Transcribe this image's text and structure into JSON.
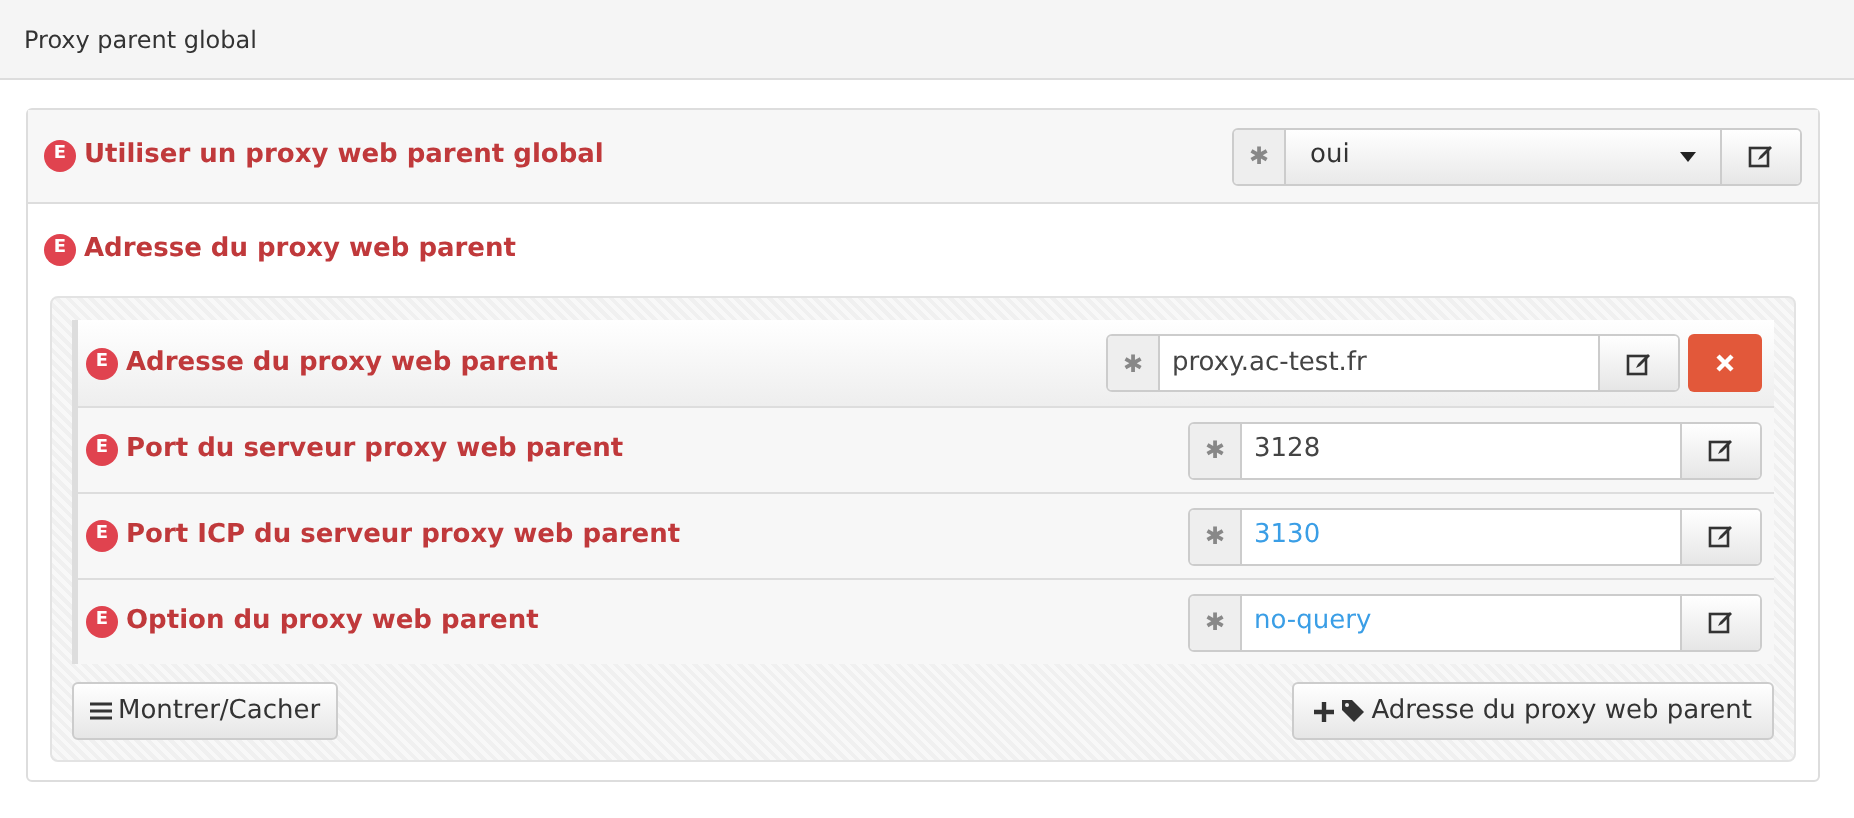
{
  "header": {
    "title": "Proxy parent global"
  },
  "global_option": {
    "badge": "E",
    "label": "Utiliser un proxy web parent global",
    "required_mark": "✱",
    "value": "oui"
  },
  "group": {
    "badge": "E",
    "label": "Adresse du proxy web parent",
    "fields": [
      {
        "badge": "E",
        "label": "Adresse du proxy web parent",
        "required_mark": "✱",
        "value": "proxy.ac-test.fr",
        "is_default": false,
        "removable": true
      },
      {
        "badge": "E",
        "label": "Port du serveur proxy web parent",
        "required_mark": "✱",
        "value": "3128",
        "is_default": false,
        "removable": false
      },
      {
        "badge": "E",
        "label": "Port ICP du serveur proxy web parent",
        "required_mark": "✱",
        "value": "3130",
        "is_default": true,
        "removable": false
      },
      {
        "badge": "E",
        "label": "Option du proxy web parent",
        "required_mark": "✱",
        "value": "no-query",
        "is_default": true,
        "removable": false
      }
    ],
    "toggle_button": "Montrer/Cacher",
    "add_button": "Adresse du proxy web parent"
  }
}
